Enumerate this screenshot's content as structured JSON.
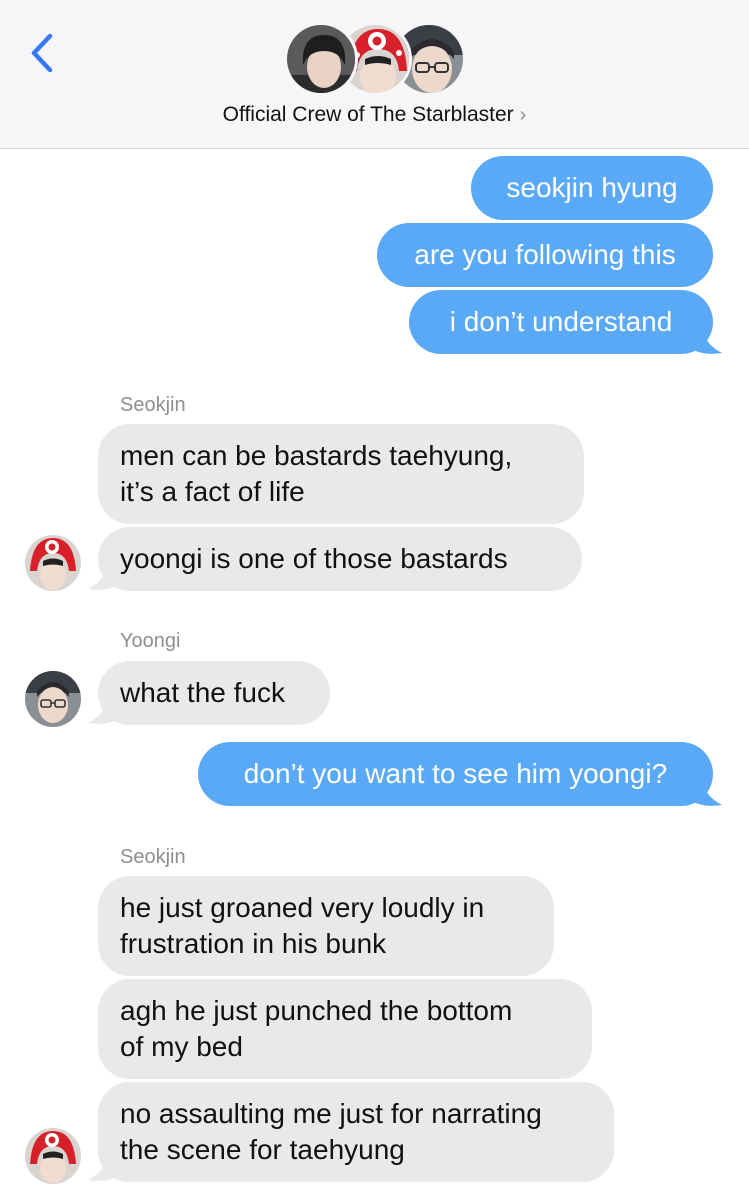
{
  "header": {
    "group_name": "Official Crew of The Starblaster",
    "chevron": "›",
    "back_icon": "chevron-left-icon",
    "accent_color": "#3478f6"
  },
  "colors": {
    "outgoing_bubble": "#5aa9f7",
    "incoming_bubble": "#e9e9eb"
  },
  "messages": {
    "m1": "seokjin hyung",
    "m2": "are you following this",
    "m3": "i don’t understand",
    "sender1": "Seokjin",
    "m4_l1": "men can be bastards taehyung,",
    "m4_l2": "it’s a fact of life",
    "m5": "yoongi is one of those bastards",
    "sender2": "Yoongi",
    "m6": "what the fuck",
    "m7": "don’t you want to see him yoongi?",
    "sender3": "Seokjin",
    "m8_l1": "he just groaned very loudly in",
    "m8_l2": "frustration in his bunk",
    "m9_l1": "agh he just punched the bottom",
    "m9_l2": "of my bed",
    "m10_l1": "no assaulting me just for narrating",
    "m10_l2": "the scene for taehyung"
  }
}
